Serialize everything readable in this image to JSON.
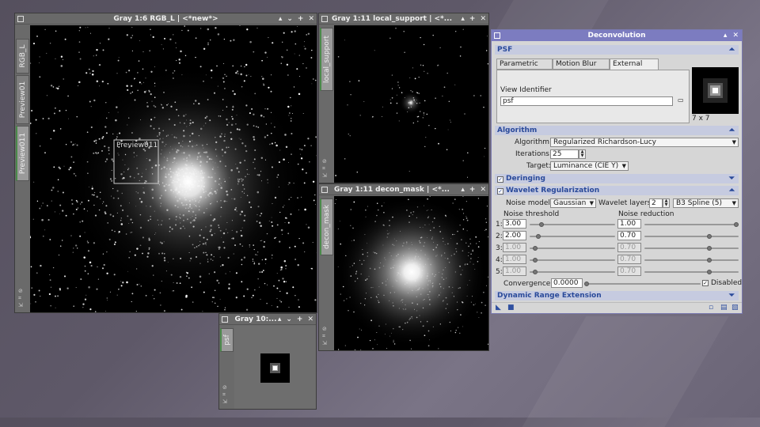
{
  "windows": {
    "main": {
      "title": "Gray 1:6 RGB_L | <*new*>",
      "tabs": [
        "RGB_L",
        "Preview01",
        "Preview011"
      ],
      "preview_label": "Preview011"
    },
    "local_support": {
      "title": "Gray 1:11 local_support | <*...",
      "tab": "local_support"
    },
    "decon_mask": {
      "title": "Gray 1:11 decon_mask | <*...",
      "tab": "decon_mask"
    },
    "psf": {
      "title": "Gray 10:...",
      "tab": "psf"
    }
  },
  "window_buttons": {
    "close": "×",
    "shade": "▴",
    "iconize": "⌄",
    "max": "+",
    "x": "✕"
  },
  "deconvolution": {
    "title": "Deconvolution",
    "psf_section": "PSF",
    "psf_tabs": [
      "Parametric PSF",
      "Motion Blur PSF",
      "External PSF"
    ],
    "view_identifier_label": "View Identifier",
    "view_identifier_value": "psf",
    "psf_size": "7 x 7",
    "algorithm_section": "Algorithm",
    "algorithm_label": "Algorithm:",
    "algorithm_value": "Regularized Richardson-Lucy",
    "iterations_label": "Iterations:",
    "iterations_value": "25",
    "target_label": "Target:",
    "target_value": "Luminance (CIE Y)",
    "deringing_section": "Deringing",
    "wavelet_section": "Wavelet Regularization",
    "noise_model_label": "Noise model:",
    "noise_model_value": "Gaussian",
    "wavelet_layers_label": "Wavelet layers:",
    "wavelet_layers_value": "2",
    "spline_value": "B3 Spline (5)",
    "noise_threshold_label": "Noise threshold",
    "noise_reduction_label": "Noise reduction",
    "layers": [
      {
        "n": "1:",
        "threshold": "3.00",
        "reduction": "1.00",
        "enabled": true,
        "t_pos": 0.12,
        "r_pos": 1.0
      },
      {
        "n": "2:",
        "threshold": "2.00",
        "reduction": "0.70",
        "enabled": true,
        "t_pos": 0.08,
        "r_pos": 0.7
      },
      {
        "n": "3:",
        "threshold": "1.00",
        "reduction": "0.70",
        "enabled": false,
        "t_pos": 0.04,
        "r_pos": 0.7
      },
      {
        "n": "4:",
        "threshold": "1.00",
        "reduction": "0.70",
        "enabled": false,
        "t_pos": 0.04,
        "r_pos": 0.7
      },
      {
        "n": "5:",
        "threshold": "1.00",
        "reduction": "0.70",
        "enabled": false,
        "t_pos": 0.04,
        "r_pos": 0.7
      }
    ],
    "convergence_label": "Convergence:",
    "convergence_value": "0.0000",
    "disabled_label": "Disabled",
    "dre_section": "Dynamic Range Extension"
  }
}
